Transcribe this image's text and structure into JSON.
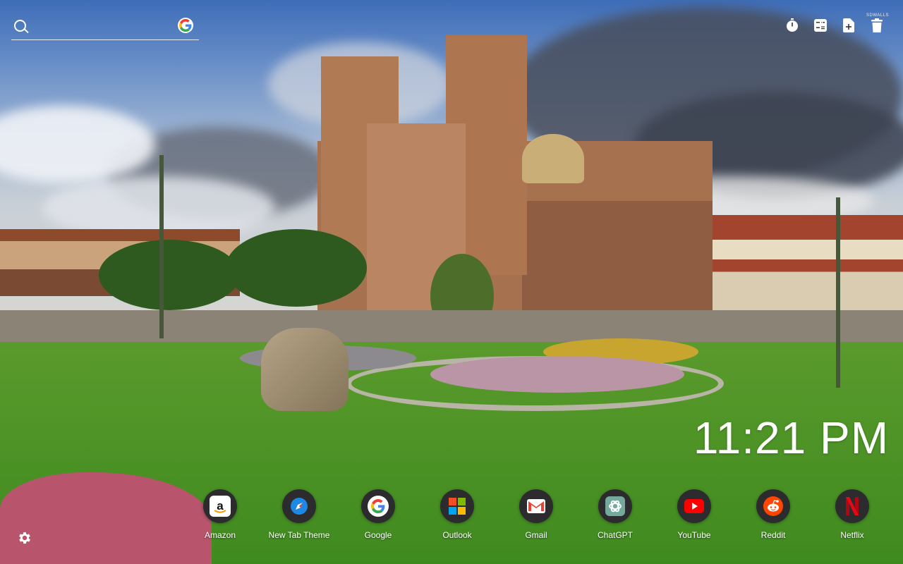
{
  "search": {
    "placeholder": "",
    "icon": "search-icon",
    "provider_icon": "google-icon"
  },
  "tools": [
    {
      "icon": "timer-icon"
    },
    {
      "icon": "calculator-icon"
    },
    {
      "icon": "add-file-icon"
    },
    {
      "icon": "trash-icon"
    }
  ],
  "brand": {
    "text": "SDWALLS"
  },
  "clock": {
    "time": "11:21 PM"
  },
  "shortcuts": [
    {
      "label": "Amazon",
      "icon": "amazon-icon"
    },
    {
      "label": "New Tab Theme",
      "icon": "compass-icon"
    },
    {
      "label": "Google",
      "icon": "google-icon"
    },
    {
      "label": "Outlook",
      "icon": "microsoft-icon"
    },
    {
      "label": "Gmail",
      "icon": "gmail-icon"
    },
    {
      "label": "ChatGPT",
      "icon": "chatgpt-icon"
    },
    {
      "label": "YouTube",
      "icon": "youtube-icon"
    },
    {
      "label": "Reddit",
      "icon": "reddit-icon"
    },
    {
      "label": "Netflix",
      "icon": "netflix-icon"
    }
  ],
  "settings": {
    "icon": "gear-icon"
  },
  "colors": {
    "shortcut_bg": "#2c2c2e",
    "text": "#ffffff",
    "youtube_red": "#ff0000",
    "reddit_orange": "#ff4500",
    "netflix_red": "#e50914"
  }
}
